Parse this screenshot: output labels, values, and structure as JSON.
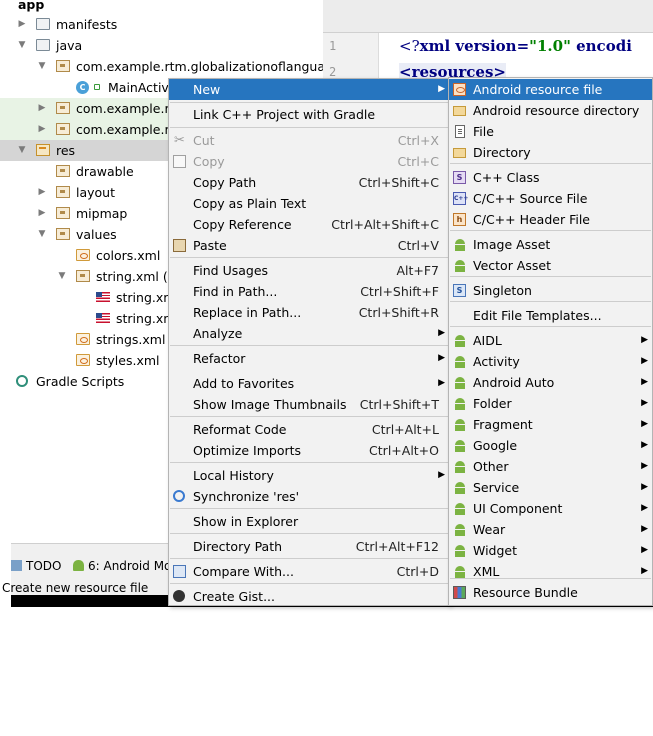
{
  "tree": {
    "items": [
      {
        "label": "app",
        "arrow": "",
        "icon": "none"
      },
      {
        "label": "manifests",
        "arrow": "▶",
        "icon": "folder"
      },
      {
        "label": "java",
        "arrow": "▼",
        "icon": "folder"
      },
      {
        "label": "com.example.rtm.globalizationoflanguage",
        "arrow": "▼",
        "icon": "package"
      },
      {
        "label": "MainActiv",
        "arrow": "",
        "icon": "class"
      },
      {
        "label": "com.example.rt",
        "arrow": "▶",
        "icon": "package"
      },
      {
        "label": "com.example.rt",
        "arrow": "▶",
        "icon": "package"
      },
      {
        "label": "res",
        "arrow": "▼",
        "icon": "res-folder"
      },
      {
        "label": "drawable",
        "arrow": "",
        "icon": "package"
      },
      {
        "label": "layout",
        "arrow": "▶",
        "icon": "package"
      },
      {
        "label": "mipmap",
        "arrow": "▶",
        "icon": "package"
      },
      {
        "label": "values",
        "arrow": "▼",
        "icon": "package"
      },
      {
        "label": "colors.xml",
        "arrow": "",
        "icon": "xml"
      },
      {
        "label": "string.xml (2",
        "arrow": "▼",
        "icon": "package"
      },
      {
        "label": "string.xm",
        "arrow": "",
        "icon": "flag"
      },
      {
        "label": "string.xm",
        "arrow": "",
        "icon": "flag"
      },
      {
        "label": "strings.xml",
        "arrow": "",
        "icon": "xml"
      },
      {
        "label": "styles.xml",
        "arrow": "",
        "icon": "xml"
      },
      {
        "label": "Gradle Scripts",
        "arrow": "",
        "icon": "gradle"
      }
    ]
  },
  "editor": {
    "line1_number": "1",
    "line2_number": "2",
    "line1_open": "<?",
    "line1_tag": "xml version=",
    "line1_value": "\"1.0\"",
    "line1_rest": " encodi",
    "line2_text": "<resources>"
  },
  "bottom": {
    "todo_label": "TODO",
    "android_monitor_label": "6: Android Mo",
    "status_text": "Create new resource file"
  },
  "context_menu": {
    "items": [
      {
        "label": "New",
        "shortcut": "",
        "submenu": true,
        "active": true,
        "disabled": false,
        "icon": ""
      },
      {
        "label": "Link C++ Project with Gradle",
        "shortcut": "",
        "submenu": false,
        "active": false,
        "disabled": false,
        "icon": ""
      },
      {
        "label": "Cut",
        "shortcut": "Ctrl+X",
        "submenu": false,
        "active": false,
        "disabled": true,
        "icon": "cut"
      },
      {
        "label": "Copy",
        "shortcut": "Ctrl+C",
        "submenu": false,
        "active": false,
        "disabled": true,
        "icon": "copy"
      },
      {
        "label": "Copy Path",
        "shortcut": "Ctrl+Shift+C",
        "submenu": false,
        "active": false,
        "disabled": false,
        "icon": ""
      },
      {
        "label": "Copy as Plain Text",
        "shortcut": "",
        "submenu": false,
        "active": false,
        "disabled": false,
        "icon": ""
      },
      {
        "label": "Copy Reference",
        "shortcut": "Ctrl+Alt+Shift+C",
        "submenu": false,
        "active": false,
        "disabled": false,
        "icon": ""
      },
      {
        "label": "Paste",
        "shortcut": "Ctrl+V",
        "submenu": false,
        "active": false,
        "disabled": false,
        "icon": "paste"
      },
      {
        "label": "Find Usages",
        "shortcut": "Alt+F7",
        "submenu": false,
        "active": false,
        "disabled": false,
        "icon": ""
      },
      {
        "label": "Find in Path...",
        "shortcut": "Ctrl+Shift+F",
        "submenu": false,
        "active": false,
        "disabled": false,
        "icon": ""
      },
      {
        "label": "Replace in Path...",
        "shortcut": "Ctrl+Shift+R",
        "submenu": false,
        "active": false,
        "disabled": false,
        "icon": ""
      },
      {
        "label": "Analyze",
        "shortcut": "",
        "submenu": true,
        "active": false,
        "disabled": false,
        "icon": ""
      },
      {
        "label": "Refactor",
        "shortcut": "",
        "submenu": true,
        "active": false,
        "disabled": false,
        "icon": ""
      },
      {
        "label": "Add to Favorites",
        "shortcut": "",
        "submenu": true,
        "active": false,
        "disabled": false,
        "icon": ""
      },
      {
        "label": "Show Image Thumbnails",
        "shortcut": "Ctrl+Shift+T",
        "submenu": false,
        "active": false,
        "disabled": false,
        "icon": ""
      },
      {
        "label": "Reformat Code",
        "shortcut": "Ctrl+Alt+L",
        "submenu": false,
        "active": false,
        "disabled": false,
        "icon": ""
      },
      {
        "label": "Optimize Imports",
        "shortcut": "Ctrl+Alt+O",
        "submenu": false,
        "active": false,
        "disabled": false,
        "icon": ""
      },
      {
        "label": "Local History",
        "shortcut": "",
        "submenu": true,
        "active": false,
        "disabled": false,
        "icon": ""
      },
      {
        "label": "Synchronize 'res'",
        "shortcut": "",
        "submenu": false,
        "active": false,
        "disabled": false,
        "icon": "sync"
      },
      {
        "label": "Show in Explorer",
        "shortcut": "",
        "submenu": false,
        "active": false,
        "disabled": false,
        "icon": ""
      },
      {
        "label": "Directory Path",
        "shortcut": "Ctrl+Alt+F12",
        "submenu": false,
        "active": false,
        "disabled": false,
        "icon": ""
      },
      {
        "label": "Compare With...",
        "shortcut": "Ctrl+D",
        "submenu": false,
        "active": false,
        "disabled": false,
        "icon": "compare"
      },
      {
        "label": "Create Gist...",
        "shortcut": "",
        "submenu": false,
        "active": false,
        "disabled": false,
        "icon": "gist"
      }
    ]
  },
  "new_submenu": {
    "items": [
      {
        "label": "Android resource file",
        "submenu": false,
        "active": true,
        "icon": "resource"
      },
      {
        "label": "Android resource directory",
        "submenu": false,
        "active": false,
        "icon": "folder"
      },
      {
        "label": "File",
        "submenu": false,
        "active": false,
        "icon": "file"
      },
      {
        "label": "Directory",
        "submenu": false,
        "active": false,
        "icon": "folder"
      },
      {
        "label": "C++ Class",
        "submenu": false,
        "active": false,
        "icon": "cpp-class"
      },
      {
        "label": "C/C++ Source File",
        "submenu": false,
        "active": false,
        "icon": "cpp-source"
      },
      {
        "label": "C/C++ Header File",
        "submenu": false,
        "active": false,
        "icon": "cpp-header"
      },
      {
        "label": "Image Asset",
        "submenu": false,
        "active": false,
        "icon": "android"
      },
      {
        "label": "Vector Asset",
        "submenu": false,
        "active": false,
        "icon": "android"
      },
      {
        "label": "Singleton",
        "submenu": false,
        "active": false,
        "icon": "singleton"
      },
      {
        "label": "Edit File Templates...",
        "submenu": false,
        "active": false,
        "icon": ""
      },
      {
        "label": "AIDL",
        "submenu": true,
        "active": false,
        "icon": "android"
      },
      {
        "label": "Activity",
        "submenu": true,
        "active": false,
        "icon": "android"
      },
      {
        "label": "Android Auto",
        "submenu": true,
        "active": false,
        "icon": "android"
      },
      {
        "label": "Folder",
        "submenu": true,
        "active": false,
        "icon": "android"
      },
      {
        "label": "Fragment",
        "submenu": true,
        "active": false,
        "icon": "android"
      },
      {
        "label": "Google",
        "submenu": true,
        "active": false,
        "icon": "android"
      },
      {
        "label": "Other",
        "submenu": true,
        "active": false,
        "icon": "android"
      },
      {
        "label": "Service",
        "submenu": true,
        "active": false,
        "icon": "android"
      },
      {
        "label": "UI Component",
        "submenu": true,
        "active": false,
        "icon": "android"
      },
      {
        "label": "Wear",
        "submenu": true,
        "active": false,
        "icon": "android"
      },
      {
        "label": "Widget",
        "submenu": true,
        "active": false,
        "icon": "android"
      },
      {
        "label": "XML",
        "submenu": true,
        "active": false,
        "icon": "android"
      },
      {
        "label": "Resource Bundle",
        "submenu": false,
        "active": false,
        "icon": "bundle"
      }
    ]
  },
  "watermark": "http://blog.csdn.net/qq_358",
  "colors": {
    "menu_highlight": "#2675bf",
    "menu_background": "#f2f2f2",
    "tree_selection": "#d5d5d5",
    "tree_highlight": "#e8f3e5"
  }
}
